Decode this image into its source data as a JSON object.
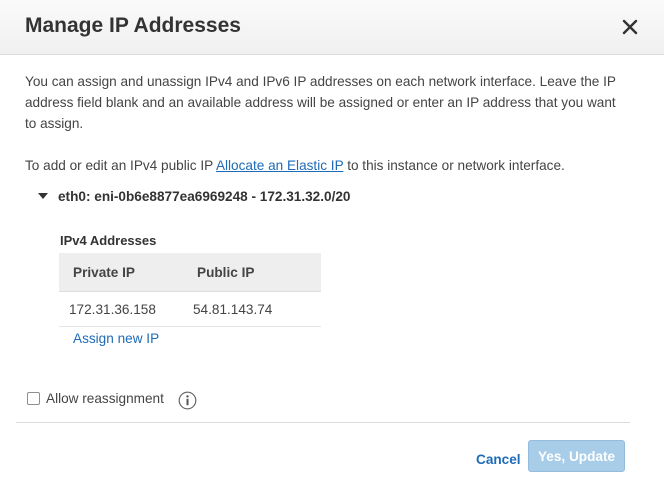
{
  "dialog": {
    "title": "Manage IP Addresses",
    "intro": "You can assign and unassign IPv4 and IPv6 IP addresses on each network interface. Leave the IP address field blank and an available address will be assigned or enter an IP address that you want to assign.",
    "public_ip_prefix": "To add or edit an IPv4 public IP",
    "public_ip_link": "Allocate an Elastic IP",
    "public_ip_suffix": "to this instance or network interface."
  },
  "interface": {
    "label": "eth0: eni-0b6e8877ea6969248 - 172.31.32.0/20",
    "section_label": "IPv4 Addresses",
    "columns": [
      "Private IP",
      "Public IP"
    ],
    "rows": [
      {
        "private_ip": "172.31.36.158",
        "public_ip": "54.81.143.74"
      }
    ],
    "assign_link": "Assign new IP"
  },
  "options": {
    "allow_reassignment_label": "Allow reassignment",
    "allow_reassignment_checked": false
  },
  "footer": {
    "cancel_label": "Cancel",
    "update_label": "Yes, Update"
  },
  "icons": {
    "close": "close-icon",
    "info": "info-icon",
    "caret": "caret-down-icon"
  },
  "colors": {
    "link": "#1e6bb8",
    "primary_button_disabled": "#a8cde8"
  }
}
